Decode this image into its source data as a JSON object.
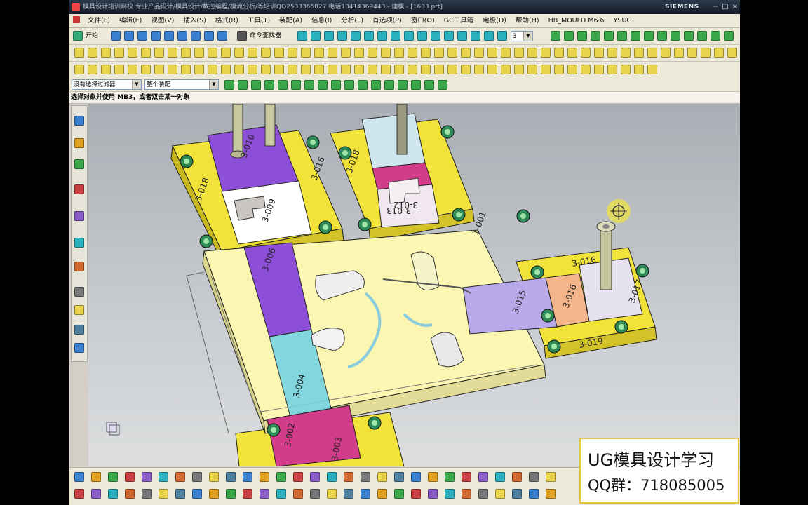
{
  "window": {
    "title": "模具设计培训网校 专业产品设计/模具设计/数控编程/模流分析/等培训QQ2533365827 电话13414369443 - 建模 - [1633.prt]",
    "brand": "SIEMENS",
    "controls": [
      "−",
      "□",
      "×"
    ]
  },
  "menubar": {
    "items": [
      "文件(F)",
      "编辑(E)",
      "视图(V)",
      "插入(S)",
      "格式(R)",
      "工具(T)",
      "装配(A)",
      "信息(I)",
      "分析(L)",
      "首选项(P)",
      "窗口(O)",
      "GC工具箱",
      "电极(D)",
      "帮助(H)",
      "HB_MOULD M6.6",
      "YSUG"
    ]
  },
  "toolbar": {
    "start_label": "开始",
    "command_finder_label": "命令查找器",
    "layer_value": "3"
  },
  "selection": {
    "filter_value": "没有选择过滤器",
    "scope_value": "整个装配"
  },
  "cue_line": "选择对象并使用 MB3，或者双击某一对象",
  "model": {
    "labels": [
      "3-010",
      "3-009",
      "3-018",
      "3-016",
      "3-018",
      "3-013",
      "3-012",
      "3-006",
      "1-001",
      "3-016",
      "3-015",
      "3-016",
      "3-017",
      "3-019",
      "3-004",
      "3-002",
      "3-003"
    ],
    "colors": {
      "plate": "#fbf6b2",
      "clamp": "#f2e33a",
      "purple": "#8e4fd8",
      "slider": "#ffffff",
      "magenta": "#d23c8a",
      "cyan": "#74d4e2",
      "lavender": "#b7a9ea",
      "orange": "#f4b58a"
    }
  },
  "watermark": {
    "line1": "UG模具设计学习",
    "line2": "QQ群：718085005"
  }
}
